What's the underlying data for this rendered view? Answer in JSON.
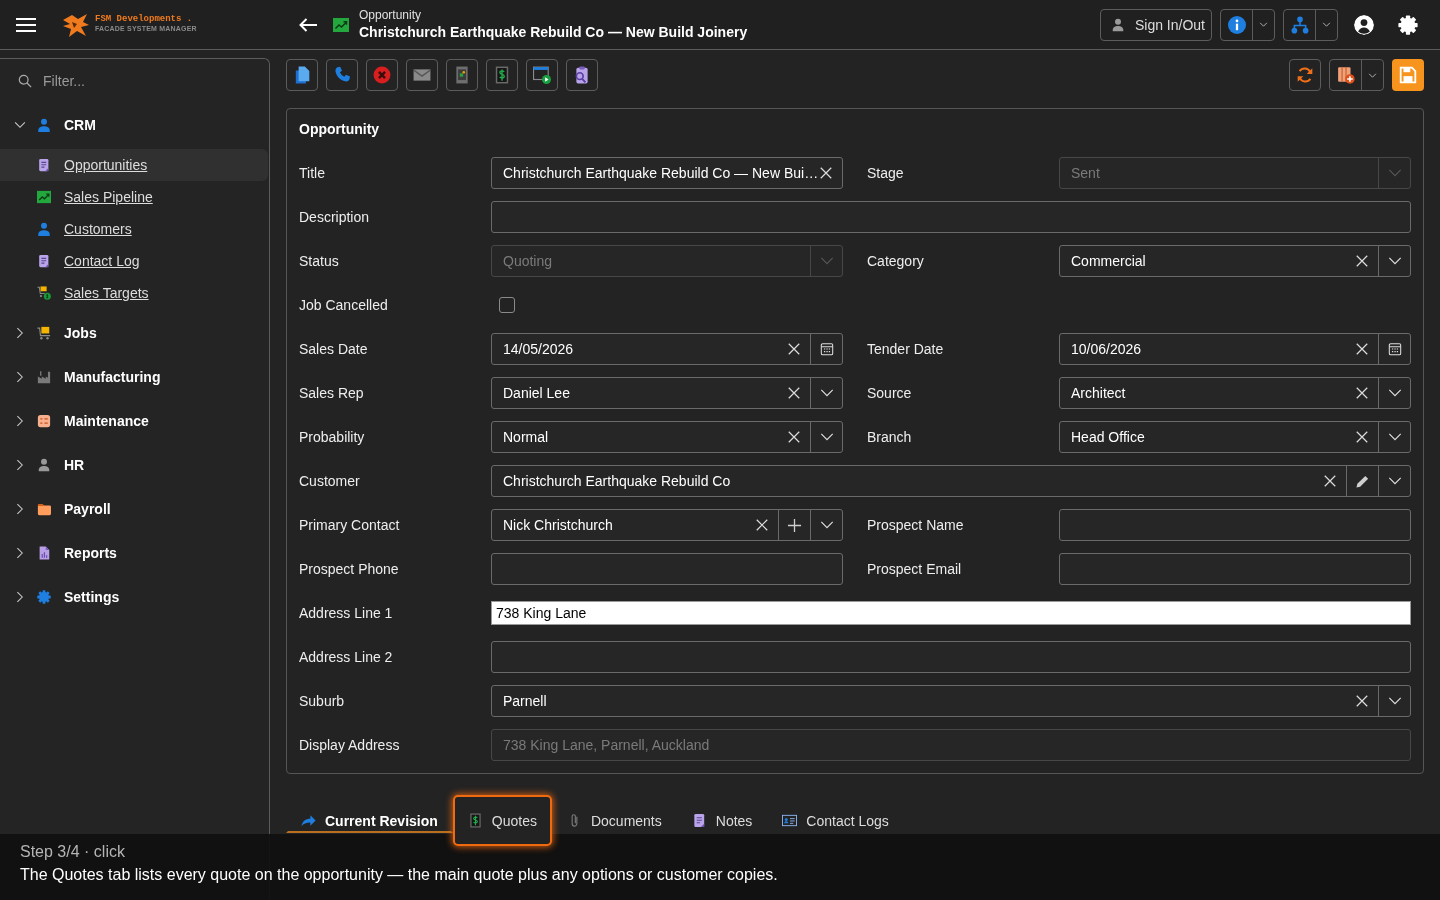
{
  "brand": {
    "name": "FSM Developments .",
    "tagline": "FACADE SYSTEM MANAGER"
  },
  "header": {
    "subtitle": "Opportunity",
    "title": "Christchurch Earthquake Rebuild Co — New Build Joinery",
    "sign_in": "Sign In/Out"
  },
  "sidebar": {
    "filter_placeholder": "Filter...",
    "groups": [
      {
        "label": "CRM",
        "expanded": true,
        "children": [
          {
            "label": "Opportunities",
            "selected": true
          },
          {
            "label": "Sales Pipeline",
            "selected": false
          },
          {
            "label": "Customers",
            "selected": false
          },
          {
            "label": "Contact Log",
            "selected": false
          },
          {
            "label": "Sales Targets",
            "selected": false
          }
        ]
      },
      {
        "label": "Jobs",
        "expanded": false
      },
      {
        "label": "Manufacturing",
        "expanded": false
      },
      {
        "label": "Maintenance",
        "expanded": false
      },
      {
        "label": "HR",
        "expanded": false
      },
      {
        "label": "Payroll",
        "expanded": false
      },
      {
        "label": "Reports",
        "expanded": false
      },
      {
        "label": "Settings",
        "expanded": false
      }
    ]
  },
  "form": {
    "title": "Opportunity",
    "rows": [
      {
        "fields": [
          {
            "label": "Title",
            "kind": "text",
            "value": "Christchurch Earthquake Rebuild Co — New Bui…",
            "disabled": false
          },
          {
            "label": "Stage",
            "kind": "dropdown",
            "value": "Sent",
            "disabled": true
          }
        ]
      },
      {
        "fields": [
          {
            "label": "Description",
            "kind": "text",
            "disabled": false
          }
        ]
      },
      {
        "fields": [
          {
            "label": "Status",
            "kind": "dropdown",
            "value": "Quoting",
            "disabled": true
          },
          {
            "label": "Category",
            "kind": "dropdown",
            "value": "Commercial",
            "disabled": false
          }
        ]
      },
      {
        "fields": [
          {
            "label": "Job Cancelled",
            "kind": "checkbox",
            "checked": false,
            "disabled": false
          }
        ]
      },
      {
        "fields": [
          {
            "label": "Sales Date",
            "kind": "date",
            "value": "14/05/2026",
            "disabled": false
          },
          {
            "label": "Tender Date",
            "kind": "date",
            "value": "10/06/2026",
            "disabled": false
          }
        ]
      },
      {
        "fields": [
          {
            "label": "Sales Rep",
            "kind": "dropdown",
            "value": "Daniel Lee",
            "disabled": false
          },
          {
            "label": "Source",
            "kind": "dropdown",
            "value": "Architect",
            "disabled": false
          }
        ]
      },
      {
        "fields": [
          {
            "label": "Probability",
            "kind": "dropdown",
            "value": "Normal",
            "disabled": false
          },
          {
            "label": "Branch",
            "kind": "dropdown",
            "value": "Head Office",
            "disabled": false
          }
        ]
      },
      {
        "fields": [
          {
            "label": "Customer",
            "kind": "dropdown",
            "value": "Christchurch Earthquake Rebuild Co",
            "extra_button": {
              "kind": "edit"
            },
            "disabled": false
          }
        ]
      },
      {
        "fields": [
          {
            "label": "Primary Contact",
            "kind": "dropdown",
            "value": "Nick Christchurch",
            "extra_button": {
              "kind": "add"
            },
            "disabled": false
          },
          {
            "label": "Prospect Name",
            "kind": "text",
            "disabled": false
          }
        ]
      },
      {
        "fields": [
          {
            "label": "Prospect Phone",
            "kind": "text",
            "disabled": false
          },
          {
            "label": "Prospect Email",
            "kind": "text",
            "disabled": false
          }
        ]
      },
      {
        "fields": [
          {
            "label": "Address Line 1",
            "kind": "autocomplete",
            "value": "738 King Lane",
            "disabled": false
          }
        ]
      },
      {
        "fields": [
          {
            "label": "Address Line 2",
            "kind": "text",
            "disabled": false
          }
        ]
      },
      {
        "fields": [
          {
            "label": "Suburb",
            "kind": "dropdown",
            "value": "Parnell",
            "disabled": false
          }
        ]
      },
      {
        "fields": [
          {
            "label": "Display Address",
            "kind": "text",
            "value": "738 King Lane, Parnell, Auckland",
            "disabled": true
          }
        ]
      }
    ]
  },
  "tabs": [
    {
      "label": "Current Revision",
      "selected": true,
      "highlighted": false
    },
    {
      "label": "Quotes",
      "selected": false,
      "highlighted": true
    },
    {
      "label": "Documents",
      "selected": false,
      "highlighted": false
    },
    {
      "label": "Notes",
      "selected": false,
      "highlighted": false
    },
    {
      "label": "Contact Logs",
      "selected": false,
      "highlighted": false
    }
  ],
  "tour": {
    "step": "Step 3/4 · click",
    "text": "The Quotes tab lists every quote on the opportunity — the main quote plus any options or customer copies."
  }
}
